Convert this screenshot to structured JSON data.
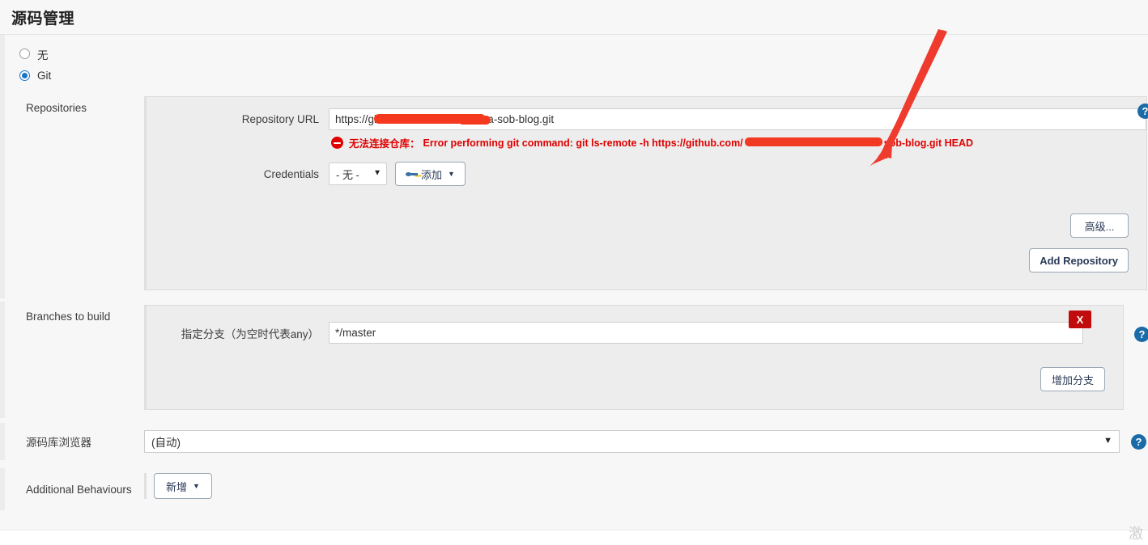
{
  "page": {
    "title": "源码管理"
  },
  "scm_options": [
    {
      "label": "无",
      "selected": false
    },
    {
      "label": "Git",
      "selected": true
    }
  ],
  "repositories": {
    "section_label": "Repositories",
    "repository_url": {
      "label": "Repository URL",
      "value": "https://github.com/xxxxxxx/xxxxa-sob-blog.git",
      "display_prefix": "https://gi",
      "display_suffix": "a-sob-blog.git",
      "redacted": true
    },
    "error": {
      "prefix": "无法连接仓库：",
      "message_head": "Error performing git command: git ls-remote -h https://github.com/",
      "message_tail": "sob-blog.git HEAD",
      "color": "#e00000"
    },
    "credentials": {
      "label": "Credentials",
      "selected": "- 无 -",
      "options": [
        "- 无 -"
      ],
      "add_button": "添加"
    },
    "advanced_button": "高级...",
    "add_repository_button": "Add Repository"
  },
  "branches": {
    "section_label": "Branches to build",
    "branch_spec": {
      "label": "指定分支（为空时代表any）",
      "value": "*/master"
    },
    "delete_button": "X",
    "add_branch_button": "增加分支"
  },
  "repository_browser": {
    "label": "源码库浏览器",
    "selected": "(自动)",
    "options": [
      "(自动)"
    ]
  },
  "additional_behaviours": {
    "label": "Additional Behaviours",
    "add_button": "新增"
  },
  "help_icon_glyph": "?",
  "watermark": "激",
  "colors": {
    "accent": "#1b75c6",
    "error": "#e00000",
    "help": "#1b6ba8",
    "delete": "#c00c0c",
    "annotation": "#ef3b2d"
  }
}
